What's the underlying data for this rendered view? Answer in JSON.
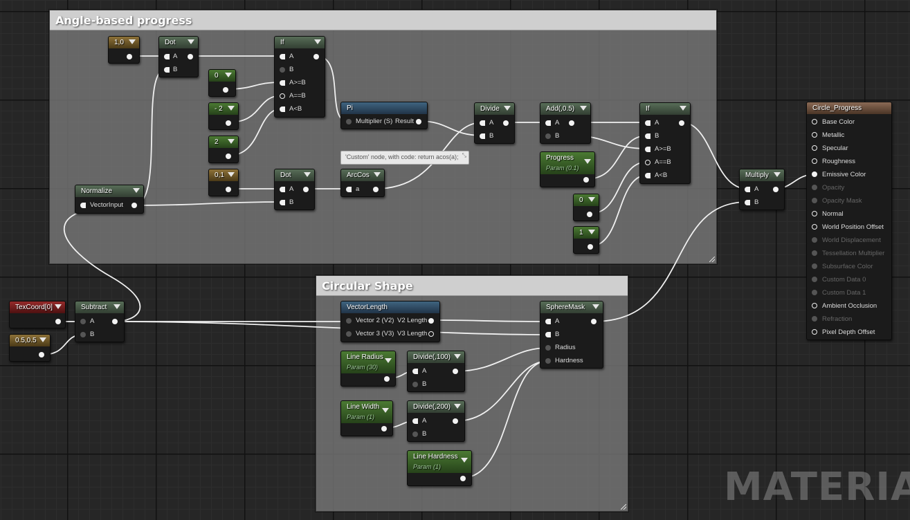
{
  "comments": {
    "angle": "Angle-based progress",
    "circular": "Circular Shape"
  },
  "nodes": {
    "const_1_0": "1,0",
    "dot1": "Dot",
    "if1": "If",
    "const_0": "0",
    "const_neg2": "- 2",
    "const_2": "2",
    "const_0_1": "0,1",
    "dot2": "Dot",
    "normalize": "Normalize",
    "normalize_pin": "VectorInput",
    "pi": "Pi",
    "pi_in": "Multiplier (S)",
    "pi_out": "Result",
    "arccos": "ArcCos",
    "arccos_pin": "a",
    "divide": "Divide",
    "add": "Add(,0.5)",
    "progress": "Progress",
    "progress_sub": "Param (0.1)",
    "if2": "If",
    "const_0b": "0",
    "const_1": "1",
    "multiply": "Multiply",
    "texcoord": "TexCoord[0]",
    "const_half": "0.5,0.5",
    "subtract": "Subtract",
    "veclen": "VectorLength",
    "veclen_in1": "Vector 2 (V2)",
    "veclen_out1": "V2 Length",
    "veclen_in2": "Vector 3 (V3)",
    "veclen_out2": "V3 Length",
    "linerad": "Line Radius",
    "linerad_sub": "Param (30)",
    "div100": "Divide(,100)",
    "linewidth": "Line Width",
    "linewidth_sub": "Param (1)",
    "div200": "Divide(,200)",
    "linehard": "Line Hardness",
    "linehard_sub": "Param (1)",
    "spheremask": "SphereMask",
    "sm_radius": "Radius",
    "sm_hardness": "Hardness"
  },
  "pins": {
    "a": "A",
    "b": "B",
    "agteb": "A>=B",
    "aeqb": "A==B",
    "altb": "A<B"
  },
  "tooltip": "'Custom' node, with code: return acos(a);",
  "material": {
    "title": "Circle_Progress",
    "inputs": [
      {
        "label": "Base Color",
        "enabled": true
      },
      {
        "label": "Metallic",
        "enabled": true
      },
      {
        "label": "Specular",
        "enabled": true
      },
      {
        "label": "Roughness",
        "enabled": true
      },
      {
        "label": "Emissive Color",
        "enabled": true
      },
      {
        "label": "Opacity",
        "enabled": false
      },
      {
        "label": "Opacity Mask",
        "enabled": false
      },
      {
        "label": "Normal",
        "enabled": true
      },
      {
        "label": "World Position Offset",
        "enabled": true
      },
      {
        "label": "World Displacement",
        "enabled": false
      },
      {
        "label": "Tessellation Multiplier",
        "enabled": false
      },
      {
        "label": "Subsurface Color",
        "enabled": false
      },
      {
        "label": "Custom Data 0",
        "enabled": false
      },
      {
        "label": "Custom Data 1",
        "enabled": false
      },
      {
        "label": "Ambient Occlusion",
        "enabled": true
      },
      {
        "label": "Refraction",
        "enabled": false
      },
      {
        "label": "Pixel Depth Offset",
        "enabled": true
      }
    ]
  },
  "watermark": "MATERIAL",
  "colors": {
    "background": "#262626",
    "wire": "#ffffff",
    "comment_title": "#cfcfcf"
  }
}
